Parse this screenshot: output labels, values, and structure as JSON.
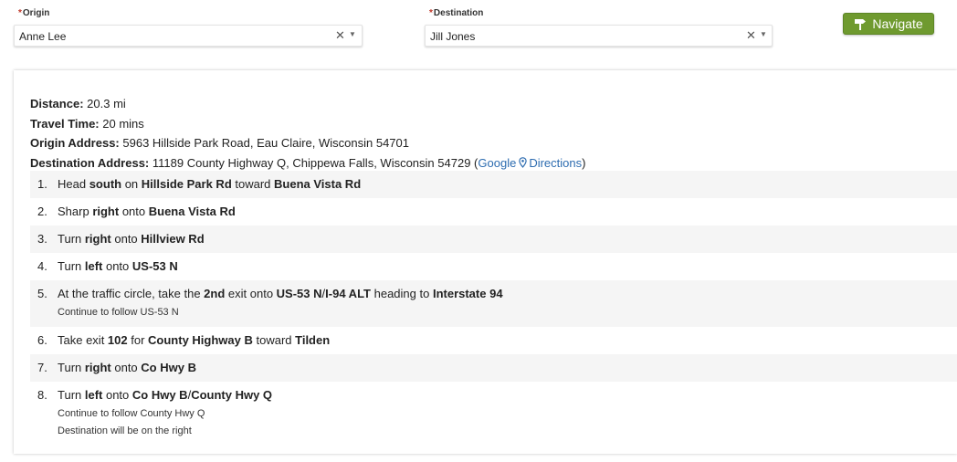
{
  "origin": {
    "label": "Origin",
    "required_mark": "*",
    "value": "Anne Lee"
  },
  "destination": {
    "label": "Destination",
    "required_mark": "*",
    "value": "Jill Jones"
  },
  "navigate_button": {
    "label": "Navigate",
    "color": "#6f9a2f"
  },
  "summary": {
    "distance_label": "Distance:",
    "distance": "20.3 mi",
    "travel_time_label": "Travel Time:",
    "travel_time": "20 mins",
    "origin_address_label": "Origin Address:",
    "origin_address": "5963 Hillside Park Road, Eau Claire, Wisconsin 54701",
    "destination_address_label": "Destination Address:",
    "destination_address": "11189 County Highway Q, Chippewa Falls, Wisconsin 54729",
    "google_link": "Google",
    "directions_link": "Directions",
    "link_color": "#2d6cb0"
  },
  "steps": [
    {
      "num": "1.",
      "parts": [
        {
          "t": "Head ",
          "b": false
        },
        {
          "t": "south",
          "b": true
        },
        {
          "t": " on ",
          "b": false
        },
        {
          "t": "Hillside Park Rd",
          "b": true
        },
        {
          "t": " toward ",
          "b": false
        },
        {
          "t": "Buena Vista Rd",
          "b": true
        }
      ],
      "notes": []
    },
    {
      "num": "2.",
      "parts": [
        {
          "t": "Sharp ",
          "b": false
        },
        {
          "t": "right",
          "b": true
        },
        {
          "t": " onto ",
          "b": false
        },
        {
          "t": "Buena Vista Rd",
          "b": true
        }
      ],
      "notes": []
    },
    {
      "num": "3.",
      "parts": [
        {
          "t": "Turn ",
          "b": false
        },
        {
          "t": "right",
          "b": true
        },
        {
          "t": " onto ",
          "b": false
        },
        {
          "t": "Hillview Rd",
          "b": true
        }
      ],
      "notes": []
    },
    {
      "num": "4.",
      "parts": [
        {
          "t": "Turn ",
          "b": false
        },
        {
          "t": "left",
          "b": true
        },
        {
          "t": " onto ",
          "b": false
        },
        {
          "t": "US-53 N",
          "b": true
        }
      ],
      "notes": []
    },
    {
      "num": "5.",
      "parts": [
        {
          "t": "At the traffic circle, take the ",
          "b": false
        },
        {
          "t": "2nd",
          "b": true
        },
        {
          "t": " exit onto ",
          "b": false
        },
        {
          "t": "US-53 N",
          "b": true
        },
        {
          "t": "/",
          "b": false
        },
        {
          "t": "I-94 ALT",
          "b": true
        },
        {
          "t": " heading to ",
          "b": false
        },
        {
          "t": "Interstate 94",
          "b": true
        }
      ],
      "notes": [
        "Continue to follow US-53 N"
      ]
    },
    {
      "num": "6.",
      "parts": [
        {
          "t": "Take exit ",
          "b": false
        },
        {
          "t": "102",
          "b": true
        },
        {
          "t": " for ",
          "b": false
        },
        {
          "t": "County Highway B",
          "b": true
        },
        {
          "t": " toward ",
          "b": false
        },
        {
          "t": "Tilden",
          "b": true
        }
      ],
      "notes": []
    },
    {
      "num": "7.",
      "parts": [
        {
          "t": "Turn ",
          "b": false
        },
        {
          "t": "right",
          "b": true
        },
        {
          "t": " onto ",
          "b": false
        },
        {
          "t": "Co Hwy B",
          "b": true
        }
      ],
      "notes": []
    },
    {
      "num": "8.",
      "parts": [
        {
          "t": "Turn ",
          "b": false
        },
        {
          "t": "left",
          "b": true
        },
        {
          "t": " onto ",
          "b": false
        },
        {
          "t": "Co Hwy B",
          "b": true
        },
        {
          "t": "/",
          "b": false
        },
        {
          "t": "County Hwy Q",
          "b": true
        }
      ],
      "notes": [
        "Continue to follow County Hwy Q",
        "Destination will be on the right"
      ]
    }
  ]
}
